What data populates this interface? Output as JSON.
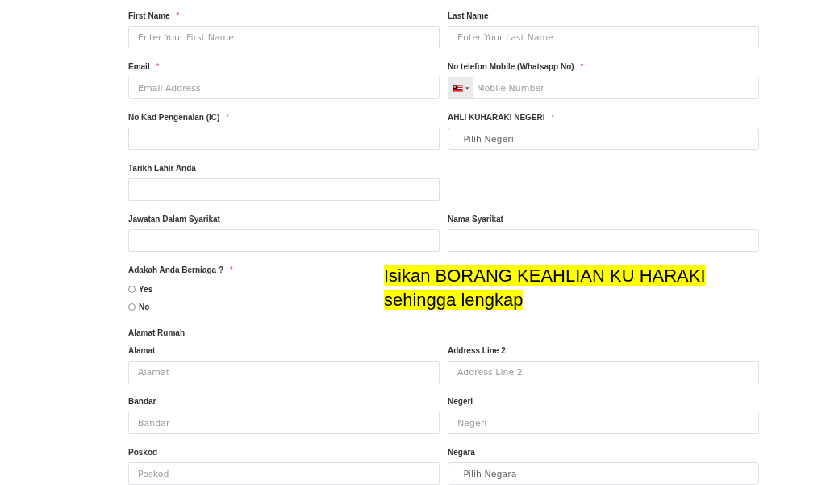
{
  "form": {
    "items": [
      {
        "kind": "row",
        "fields": [
          {
            "label": "First Name",
            "required_mark": "*",
            "kind": "text",
            "placeholder": "Enter Your First Name"
          },
          {
            "label": "Last Name",
            "kind": "text",
            "placeholder": "Enter Your Last Name"
          }
        ]
      },
      {
        "kind": "row",
        "fields": [
          {
            "label": "Email",
            "required_mark": "*",
            "kind": "text",
            "placeholder": "Email Address"
          },
          {
            "label": "No telefon Mobile (Whatsapp No)",
            "required_mark": "*",
            "kind": "phone",
            "placeholder": "Mobile Number"
          }
        ]
      },
      {
        "kind": "row",
        "fields": [
          {
            "label": "No Kad Pengenalan (IC)",
            "required_mark": "*",
            "kind": "text"
          },
          {
            "label": "AHLI KUHARAKI NEGERI",
            "required_mark": "*",
            "kind": "select",
            "value": "- Pilih Negeri -"
          }
        ]
      },
      {
        "kind": "row",
        "fields": [
          {
            "label": "Tarikh Lahir Anda",
            "kind": "text"
          }
        ]
      },
      {
        "kind": "row",
        "fields": [
          {
            "label": "Jawatan Dalam Syarikat",
            "kind": "text"
          },
          {
            "label": "Nama Syarikat",
            "kind": "text"
          }
        ]
      },
      {
        "kind": "radio_group",
        "label": "Adakah Anda Berniaga ?",
        "required_mark": "*",
        "options": [
          {
            "label": "Yes",
            "selected": false
          },
          {
            "label": "No",
            "selected": false
          }
        ]
      },
      {
        "kind": "heading",
        "text": "Alamat Rumah"
      },
      {
        "kind": "row",
        "fields": [
          {
            "label": "Alamat",
            "kind": "text",
            "placeholder": "Alamat"
          },
          {
            "label": "Address Line 2",
            "kind": "text",
            "placeholder": "Address Line 2"
          }
        ]
      },
      {
        "kind": "row",
        "fields": [
          {
            "label": "Bandar",
            "kind": "text",
            "placeholder": "Bandar"
          },
          {
            "label": "Negeri",
            "kind": "text",
            "placeholder": "Negeri"
          }
        ]
      },
      {
        "kind": "row",
        "fields": [
          {
            "label": "Poskod",
            "kind": "text",
            "placeholder": "Poskod"
          },
          {
            "label": "Negara",
            "kind": "select",
            "value": "- Pilih Negara -"
          }
        ]
      }
    ]
  },
  "annotation": {
    "lines": [
      "Isikan BORANG KEAHLIAN KU HARAKI",
      "sehingga lengkap"
    ]
  }
}
